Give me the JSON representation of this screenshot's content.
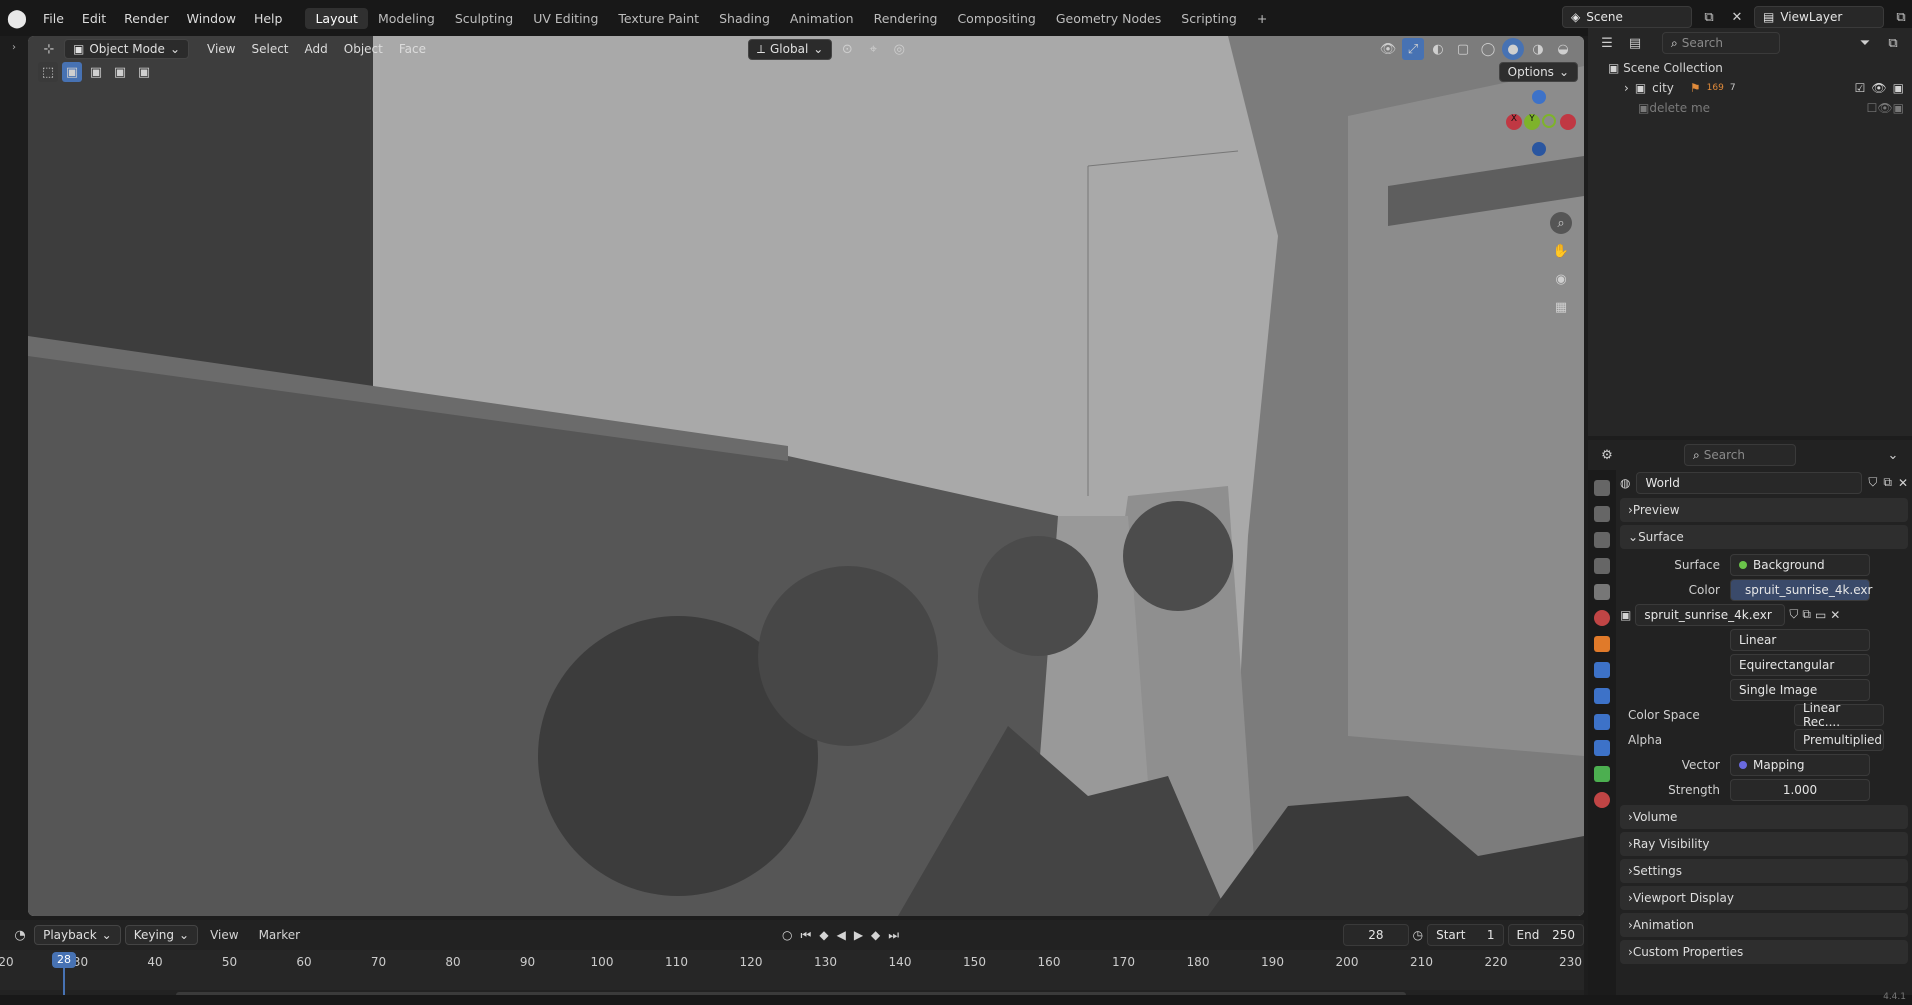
{
  "topbar": {
    "menus": [
      "File",
      "Edit",
      "Render",
      "Window",
      "Help"
    ],
    "tabs": [
      "Layout",
      "Modeling",
      "Sculpting",
      "UV Editing",
      "Texture Paint",
      "Shading",
      "Animation",
      "Rendering",
      "Compositing",
      "Geometry Nodes",
      "Scripting"
    ],
    "scene": "Scene",
    "view_layer": "ViewLayer"
  },
  "viewport": {
    "mode": "Object Mode",
    "menus": [
      "View",
      "Select",
      "Add",
      "Object",
      "Face"
    ],
    "transform": "Global",
    "options": "Options",
    "gizmo": {
      "x": "X",
      "y": "Y"
    }
  },
  "outliner": {
    "search_placeholder": "Search",
    "root": "Scene Collection",
    "items": [
      {
        "name": "city",
        "badge": "169",
        "count": "7"
      },
      {
        "name": "delete me"
      }
    ]
  },
  "properties": {
    "search_placeholder": "Search",
    "datablock": "World",
    "panels": {
      "preview": "Preview",
      "surface": "Surface",
      "volume": "Volume",
      "ray_visibility": "Ray Visibility",
      "settings": "Settings",
      "viewport_display": "Viewport Display",
      "animation": "Animation",
      "custom_properties": "Custom Properties"
    },
    "surface": {
      "surface_label": "Surface",
      "surface_value": "Background",
      "color_label": "Color",
      "color_value": "spruit_sunrise_4k.exr",
      "image": "spruit_sunrise_4k.exr",
      "interpolation": "Linear",
      "projection": "Equirectangular",
      "source": "Single Image",
      "color_space_label": "Color Space",
      "color_space": "Linear Rec....",
      "alpha_label": "Alpha",
      "alpha": "Premultiplied",
      "vector_label": "Vector",
      "vector": "Mapping",
      "strength_label": "Strength",
      "strength": "1.000"
    }
  },
  "timeline": {
    "menus": [
      "Playback",
      "Keying",
      "View",
      "Marker"
    ],
    "current_frame": "28",
    "start_label": "Start",
    "start": "1",
    "end_label": "End",
    "end": "250",
    "ticks": [
      "20",
      "30",
      "40",
      "50",
      "60",
      "70",
      "80",
      "90",
      "100",
      "110",
      "120",
      "130",
      "140",
      "150",
      "160",
      "170",
      "180",
      "190",
      "200",
      "210",
      "220",
      "230"
    ],
    "playhead": "28"
  },
  "version": "4.4.1",
  "colors": {
    "accent": "#4772b3",
    "x_axis": "#c03843",
    "y_axis": "#7eb32b",
    "z_axis": "#3d72c8"
  }
}
